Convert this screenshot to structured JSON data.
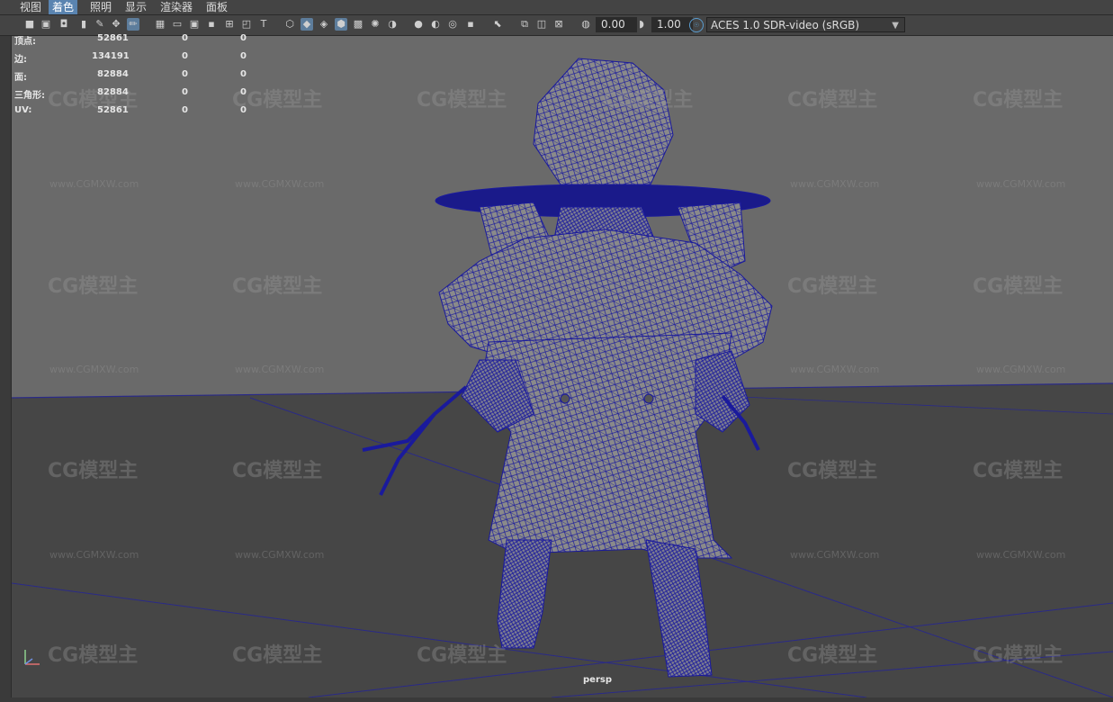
{
  "menu": {
    "items": [
      "视图",
      "着色",
      "照明",
      "显示",
      "渲染器",
      "面板"
    ],
    "active_index": 1
  },
  "toolbar": {
    "exposure_value": "0.00",
    "gamma_value": "1.00",
    "color_space": "ACES 1.0 SDR-video (sRGB)"
  },
  "hud": {
    "rows": [
      {
        "label": "顶点:",
        "v1": "52861",
        "v2": "0",
        "v3": "0"
      },
      {
        "label": "边:",
        "v1": "134191",
        "v2": "0",
        "v3": "0"
      },
      {
        "label": "面:",
        "v1": "82884",
        "v2": "0",
        "v3": "0"
      },
      {
        "label": "三角形:",
        "v1": "82884",
        "v2": "0",
        "v3": "0"
      },
      {
        "label": "UV:",
        "v1": "52861",
        "v2": "0",
        "v3": "0"
      }
    ]
  },
  "camera_label": "persp",
  "colors": {
    "background_upper": "#6a6a6a",
    "background_lower": "#464646",
    "wireframe": "#1a1a9c",
    "mesh_fill": "#8a8a8a",
    "active_menu": "#5a84b0"
  },
  "watermark": {
    "logo": "CG模型主",
    "url": "www.CGMXW.com"
  }
}
